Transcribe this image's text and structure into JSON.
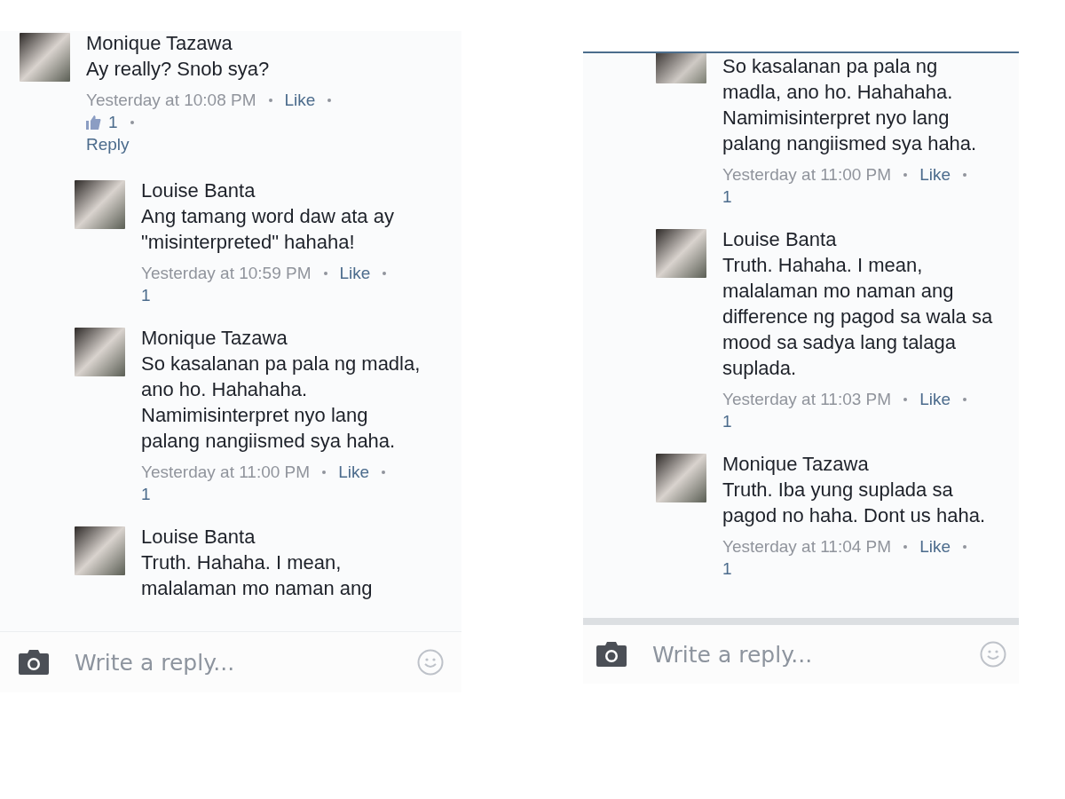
{
  "panels": [
    {
      "comments": [
        {
          "author": "Monique Tazawa",
          "text": "Ay really? Snob sya?",
          "time": "Yesterday at 10:08 PM",
          "like": "Like",
          "reactions": "1",
          "reply": "Reply",
          "replies": [
            {
              "author": "Louise Banta",
              "text": "Ang tamang word daw ata ay \"misinterpreted\" hahaha!",
              "time": "Yesterday at 10:59 PM",
              "like": "Like",
              "count": "1"
            },
            {
              "author": "Monique Tazawa",
              "text": "So kasalanan pa pala ng madla, ano ho. Hahahaha. Namimisinterpret nyo lang palang nangiismed sya haha.",
              "time": "Yesterday at 11:00 PM",
              "like": "Like",
              "count": "1"
            },
            {
              "author": "Louise Banta",
              "text": "Truth. Hahaha. I mean, malalaman mo naman ang"
            }
          ]
        }
      ],
      "composer": {
        "placeholder": "Write a reply..."
      }
    },
    {
      "replies": [
        {
          "text": "So kasalanan pa pala ng madla, ano ho. Hahahaha. Namimisinterpret nyo lang palang nangiismed sya haha.",
          "time": "Yesterday at 11:00 PM",
          "like": "Like",
          "count": "1"
        },
        {
          "author": "Louise Banta",
          "text": "Truth. Hahaha. I mean, malalaman mo naman ang difference ng pagod sa wala sa mood sa sadya lang talaga suplada.",
          "time": "Yesterday at 11:03 PM",
          "like": "Like",
          "count": "1"
        },
        {
          "author": "Monique Tazawa",
          "text": "Truth. Iba yung suplada sa pagod no haha. Dont us haha.",
          "time": "Yesterday at 11:04 PM",
          "like": "Like",
          "count": "1"
        }
      ],
      "composer": {
        "placeholder": "Write a reply..."
      }
    }
  ]
}
